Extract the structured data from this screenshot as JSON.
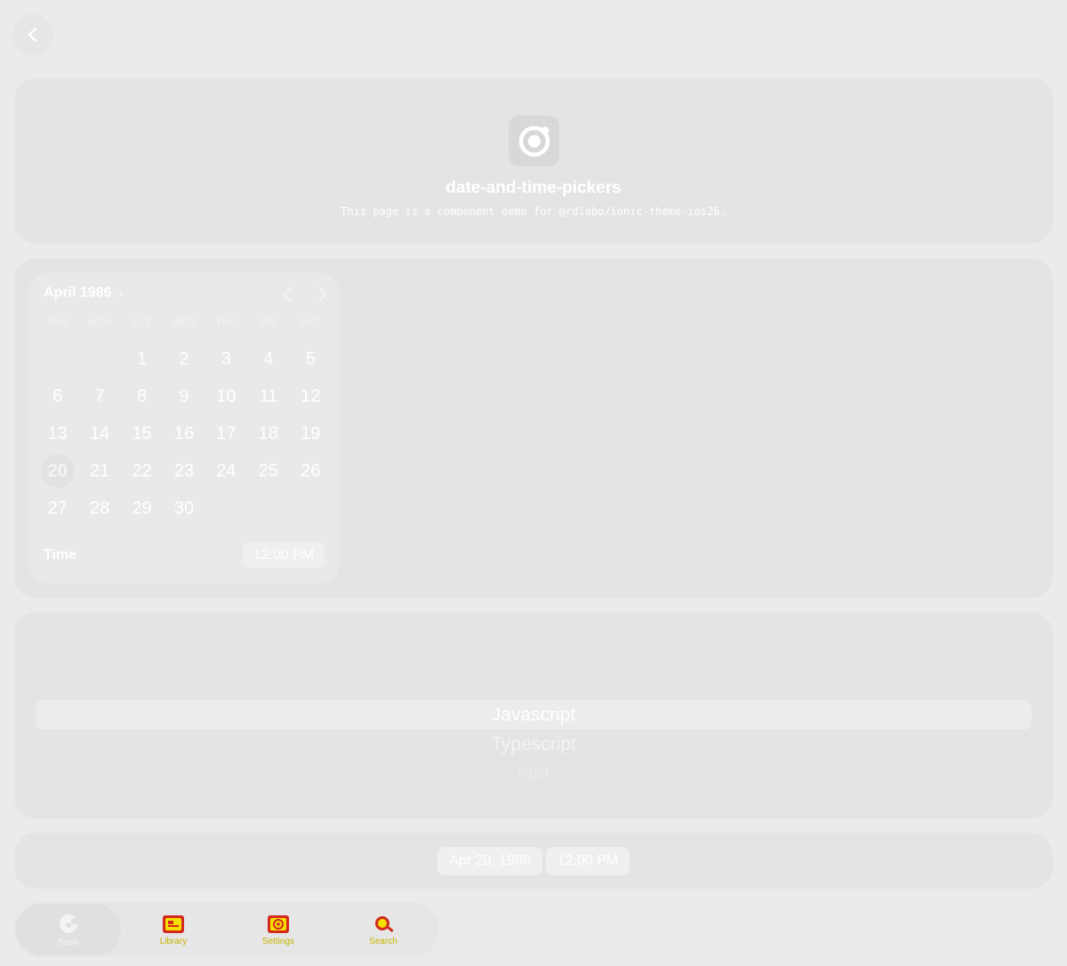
{
  "header": {
    "back_icon": "chevron-left-icon",
    "app_icon": "ionic-logo-icon",
    "title": "date-and-time-pickers",
    "description": "This page is a component demo for @rdlabo/ionic-theme-ios26."
  },
  "calendar": {
    "month_label": "April 1986",
    "month_expand_icon": "chevron-right-icon",
    "prev_icon": "chevron-left-icon",
    "next_icon": "chevron-right-icon",
    "weekdays": [
      "SUN",
      "MON",
      "TUE",
      "WED",
      "THU",
      "FRI",
      "SAT"
    ],
    "leading_blanks": 2,
    "days": [
      "1",
      "2",
      "3",
      "4",
      "5",
      "6",
      "7",
      "8",
      "9",
      "10",
      "11",
      "12",
      "13",
      "14",
      "15",
      "16",
      "17",
      "18",
      "19",
      "20",
      "21",
      "22",
      "23",
      "24",
      "25",
      "26",
      "27",
      "28",
      "29",
      "30"
    ],
    "selected_day": "20",
    "time_label": "Time",
    "time_value": "12:00 PM"
  },
  "picker": {
    "options": [
      "Javascript",
      "Typescript",
      "Rust"
    ],
    "selected": "Javascript"
  },
  "datetime_buttons": {
    "date": "Apr 20, 1986",
    "time": "12:00 PM"
  },
  "tabs": [
    {
      "label": "Basic",
      "icon": "ionic-tab-icon",
      "active": true
    },
    {
      "label": "Library",
      "icon": "library-icon",
      "active": false
    },
    {
      "label": "Settings",
      "icon": "settings-icon",
      "active": false
    },
    {
      "label": "Search",
      "icon": "search-icon",
      "active": false
    }
  ],
  "colors": {
    "background": "#ebebeb",
    "card": "#e4e4e4",
    "tab_icon_red": "#d42a1e",
    "tab_icon_yellow": "#f5e000"
  }
}
